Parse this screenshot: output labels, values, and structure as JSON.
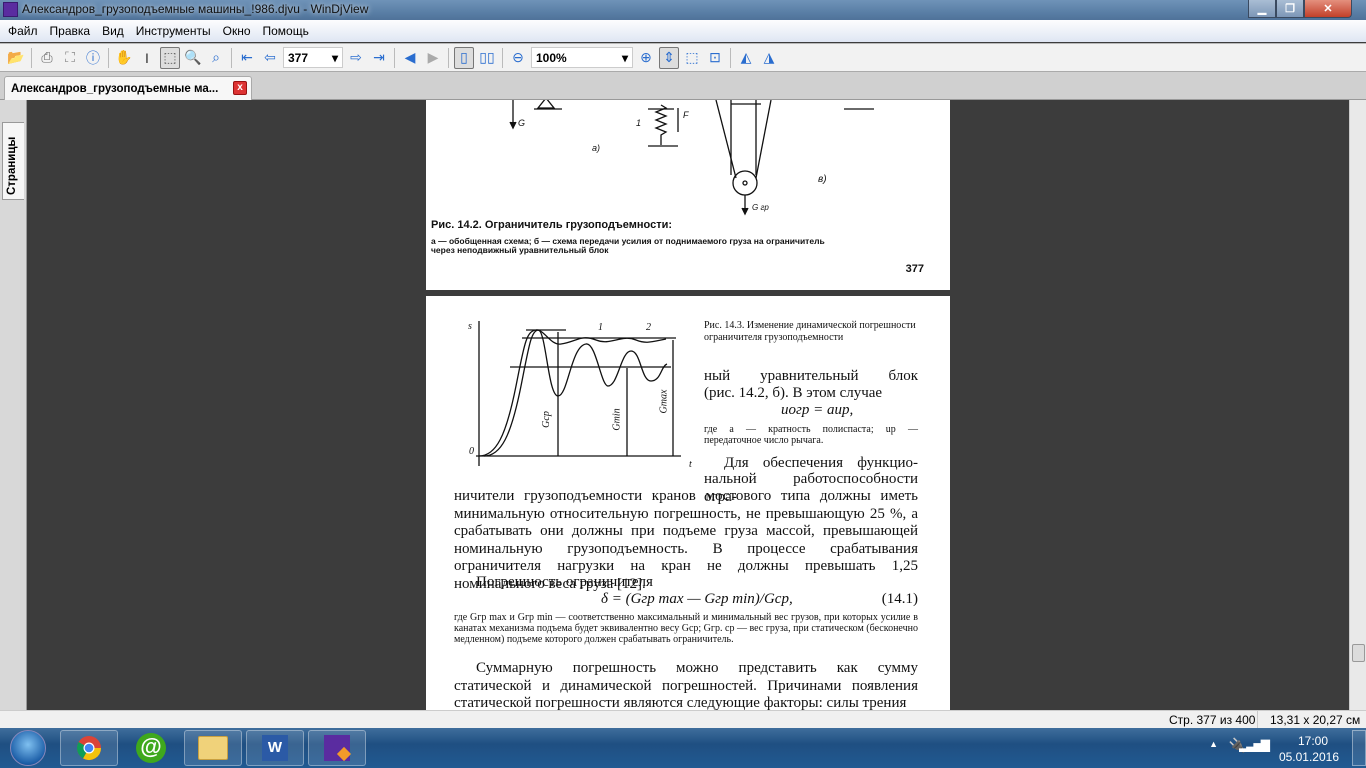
{
  "window": {
    "title": "Александров_грузоподъемные машины_!986.djvu - WinDjView"
  },
  "menu": [
    "Файл",
    "Правка",
    "Вид",
    "Инструменты",
    "Окно",
    "Помощь"
  ],
  "toolbar": {
    "page_value": "377",
    "zoom_value": "100%"
  },
  "tab": {
    "label": "Александров_грузоподъемные ма...",
    "close": "x"
  },
  "sidebar": {
    "pages_tab": "Страницы"
  },
  "page1": {
    "fig_labels": {
      "g": "G",
      "f": "F",
      "one": "1",
      "a": "а)",
      "b": "в)",
      "ggr": "G гр"
    },
    "caption": "Рис. 14.2. Ограничитель грузоподъемности:",
    "caption_note_1": "а — обобщенная схема; б — схема передачи усилия от поднимаемого груза на ограничитель",
    "caption_note_2": "через неподвижный уравнительный блок",
    "page_number": "377"
  },
  "page2": {
    "graph_labels": {
      "s": "s",
      "zero": "0",
      "t": "t",
      "one": "1",
      "two": "2",
      "gcp": "Gср",
      "gmin": "Gmin",
      "gmax": "Gmax"
    },
    "fig_caption": "Рис. 14.3. Изменение динамической погрешности ограничителя грузоподъемности",
    "side_lines": [
      "ный уравнительный блок",
      "(рис. 14.2, б). В этом случае"
    ],
    "formula1": "uогр = auр,",
    "side_note": "где a — кратность полиспаста; uр — передаточное число рычага.",
    "para1_start": "Для обеспечения функцио-",
    "para1_line2": "нальной работоспособности огра-",
    "para1_rest": "ничители грузоподъемности кранов мостового типа должны иметь минимальную относительную погрешность, не превышающую 25 %, а срабатывать они должны при подъеме груза массой, превышающей номинальную грузоподъемность. В процессе срабатывания ограничителя нагрузки на кран не должны превышать 1,25 номинального веса груза [12].",
    "para2": "Погрешность ограничителя",
    "formula2": "δ = (Gгр max — Gгр min)/Gср,",
    "formula2_num": "(14.1)",
    "note2": "где Gгр max и Gгр min — соответственно максимальный и минимальный вес грузов, при которых усилие в канатах механизма подъема будет эквивалентно весу Gср; Gгр. ср — вес груза, при статическом (бесконечно медленном) подъеме которого должен срабатывать ограничитель.",
    "para3": "Суммарную погрешность можно представить как сумму статической и динамической погрешностей. Причинами появления статической погрешности являются следующие факторы: силы трения"
  },
  "status": {
    "page": "Стр. 377 из 400",
    "size": "13,31 x 20,27 см"
  },
  "tray": {
    "time": "17:00",
    "date": "05.01.2016"
  }
}
